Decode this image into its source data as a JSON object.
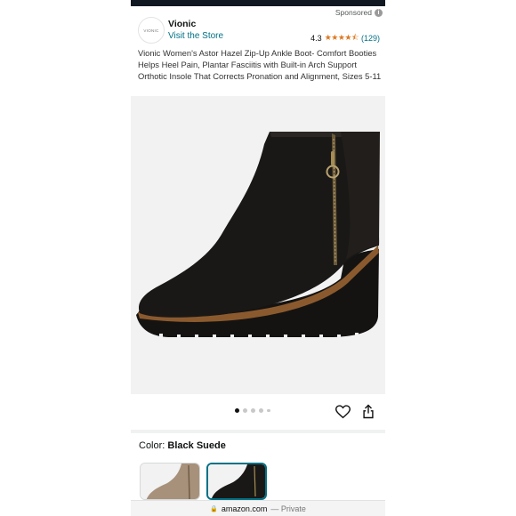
{
  "header": {
    "sponsored_label": "Sponsored",
    "info_icon_glyph": "i"
  },
  "brand": {
    "logo_text": "VIONIC",
    "name": "Vionic",
    "store_link": "Visit the Store"
  },
  "rating": {
    "value": "4.3",
    "stars_glyphs": "★★★★⯪",
    "count": "(129)",
    "color": "#de7921"
  },
  "product": {
    "title": "Vionic Women's Astor Hazel Zip-Up Ankle Boot- Comfort Booties Helps Heel Pain, Plantar Fasciitis with Built-in Arch Support Orthotic Insole That Corrects Pronation and Alignment, Sizes 5-11"
  },
  "gallery": {
    "image_count": 5,
    "active_index": 0,
    "favorite_icon": "heart-icon",
    "share_icon": "share-icon"
  },
  "variant": {
    "color_label": "Color: ",
    "color_value": "Black Suede",
    "swatches": [
      {
        "name": "Taupe",
        "selected": false,
        "color": "#a8917a"
      },
      {
        "name": "Black Suede",
        "selected": true,
        "color": "#1a1816"
      }
    ]
  },
  "urlbar": {
    "lock_icon": "lock-icon",
    "domain": "amazon.com",
    "mode": "— Private"
  },
  "colors": {
    "link": "#007185",
    "text": "#0f1111",
    "image_bg": "#f2f2f2"
  }
}
